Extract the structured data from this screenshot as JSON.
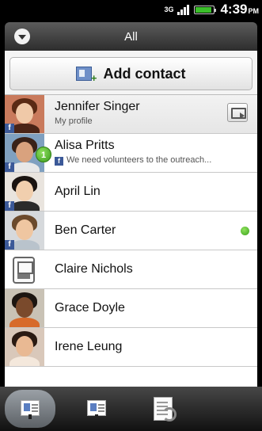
{
  "status_bar": {
    "network": "3G",
    "time": "4:39",
    "ampm": "PM",
    "battery_level": 0.9,
    "icons": [
      "signal-icon",
      "battery-icon"
    ]
  },
  "header": {
    "title": "All",
    "icons": [
      "dropdown-icon"
    ]
  },
  "add_contact": {
    "label": "Add contact",
    "icon": "add-contact-icon"
  },
  "contacts": [
    {
      "name": "Jennifer Singer",
      "subtitle": "My profile",
      "facebook": true,
      "action_icon": "contact-card-icon"
    },
    {
      "name": "Alisa Pritts",
      "status": "We need volunteers to the outreach...",
      "facebook": true,
      "badge": "1"
    },
    {
      "name": "April Lin",
      "facebook": true
    },
    {
      "name": "Ben Carter",
      "facebook": true,
      "online": true
    },
    {
      "name": "Claire Nichols",
      "icon": "phone-contact-icon"
    },
    {
      "name": "Grace Doyle"
    },
    {
      "name": "Irene Leung"
    }
  ],
  "tabs": [
    {
      "name": "people-tab",
      "icon": "contacts-card-icon",
      "active": true
    },
    {
      "name": "groups-tab",
      "icon": "groups-card-icon",
      "active": false
    },
    {
      "name": "call-history-tab",
      "icon": "call-history-icon",
      "active": false
    }
  ],
  "colors": {
    "facebook": "#3b5998",
    "online": "#3aa11b",
    "badge": "#3a9a1c",
    "tab_active": "#7a8086"
  }
}
